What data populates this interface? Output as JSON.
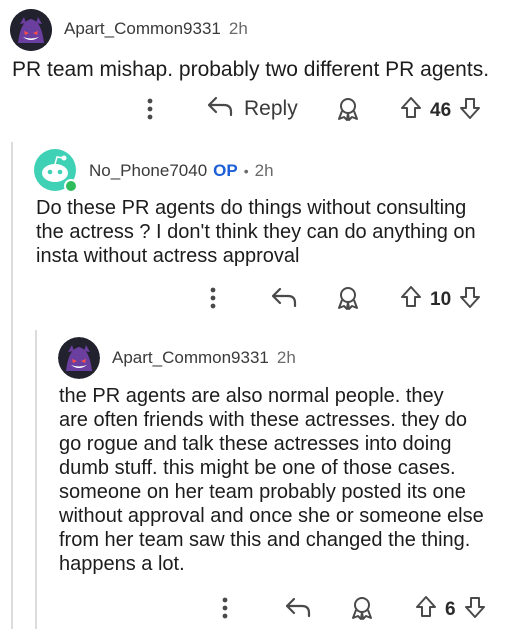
{
  "comments": [
    {
      "username": "Apart_Common9331",
      "time": "2h",
      "body": "PR team mishap. probably two different PR agents.",
      "reply_label": "Reply",
      "score": "46"
    },
    {
      "username": "No_Phone7040",
      "op_badge": "OP",
      "separator": "•",
      "time": "2h",
      "body_lines": [
        "Do these PR agents do things without consulting",
        "the actress ? I don't think they can do anything on",
        "insta without actress approval"
      ],
      "score": "10"
    },
    {
      "username": "Apart_Common9331",
      "time": "2h",
      "body_lines": [
        "the PR agents are also normal people. they",
        "are often friends with these actresses. they do",
        "go rogue and talk these actresses into doing",
        "dumb stuff. this might be one of those cases.",
        "someone on her team probably posted its one",
        "without approval and once she or someone else",
        "from her team saw this and changed the thing.",
        "happens a lot."
      ],
      "score": "6"
    }
  ],
  "icons": {
    "more": "more-vertical-icon",
    "reply": "reply-arrow-icon",
    "award": "award-icon",
    "upvote": "upvote-arrow-icon",
    "downvote": "downvote-arrow-icon"
  },
  "colors": {
    "username": "#3a3a3a",
    "op_badge": "#1c5fd6",
    "text": "#1c1c1c",
    "avatar_ghost_bg": "#1a1a22",
    "avatar_snoo_bg": "#3fd1b5"
  }
}
